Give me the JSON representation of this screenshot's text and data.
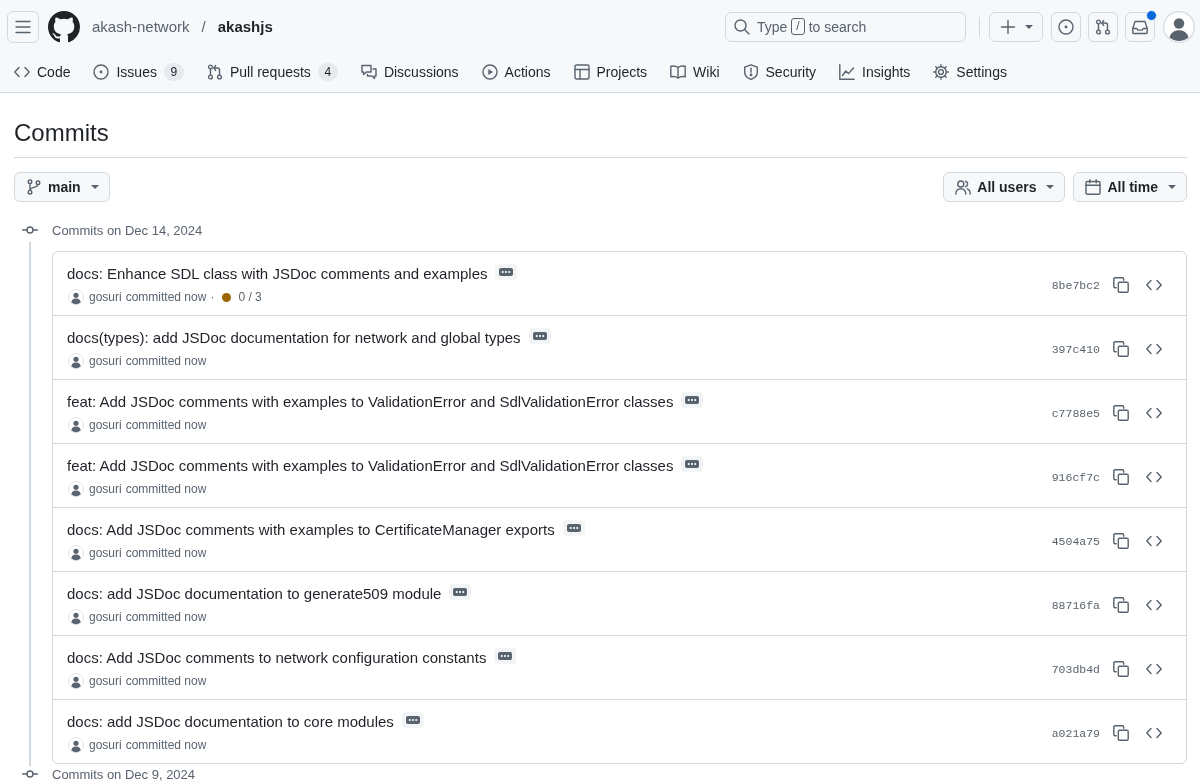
{
  "header": {
    "owner": "akash-network",
    "separator": "/",
    "repo": "akashjs",
    "search": {
      "hint_before": "Type",
      "key": "/",
      "hint_after": "to search"
    },
    "notifications_unread": true
  },
  "tabs": [
    {
      "label": "Code",
      "selected": false
    },
    {
      "label": "Issues",
      "count": "9",
      "selected": false
    },
    {
      "label": "Pull requests",
      "count": "4",
      "selected": false
    },
    {
      "label": "Discussions",
      "selected": false
    },
    {
      "label": "Actions",
      "selected": false
    },
    {
      "label": "Projects",
      "selected": false
    },
    {
      "label": "Wiki",
      "selected": false
    },
    {
      "label": "Security",
      "selected": false
    },
    {
      "label": "Insights",
      "selected": false
    },
    {
      "label": "Settings",
      "selected": false
    }
  ],
  "page_title": "Commits",
  "filters": {
    "branch": "main",
    "users": "All users",
    "time": "All time"
  },
  "groups": [
    {
      "heading": "Commits on Dec 14, 2024",
      "commits": [
        {
          "title": "docs: Enhance SDL class with JSDoc comments and examples",
          "author": "gosuri",
          "action": "committed now",
          "checks": {
            "separator": "·",
            "pending": true,
            "text": "0 / 3"
          },
          "hash": "8be7bc2"
        },
        {
          "title": "docs(types): add JSDoc documentation for network and global types",
          "author": "gosuri",
          "action": "committed now",
          "hash": "397c410"
        },
        {
          "title": "feat: Add JSDoc comments with examples to ValidationError and SdlValidationError classes",
          "author": "gosuri",
          "action": "committed now",
          "hash": "c7788e5"
        },
        {
          "title": "feat: Add JSDoc comments with examples to ValidationError and SdlValidationError classes",
          "author": "gosuri",
          "action": "committed now",
          "hash": "916cf7c"
        },
        {
          "title": "docs: Add JSDoc comments with examples to CertificateManager exports",
          "author": "gosuri",
          "action": "committed now",
          "hash": "4504a75"
        },
        {
          "title": "docs: add JSDoc documentation to generate509 module",
          "author": "gosuri",
          "action": "committed now",
          "hash": "88716fa"
        },
        {
          "title": "docs: Add JSDoc comments to network configuration constants",
          "author": "gosuri",
          "action": "committed now",
          "hash": "703db4d"
        },
        {
          "title": "docs: add JSDoc documentation to core modules",
          "author": "gosuri",
          "action": "committed now",
          "hash": "a021a79"
        }
      ]
    },
    {
      "heading": "Commits on Dec 9, 2024"
    }
  ]
}
